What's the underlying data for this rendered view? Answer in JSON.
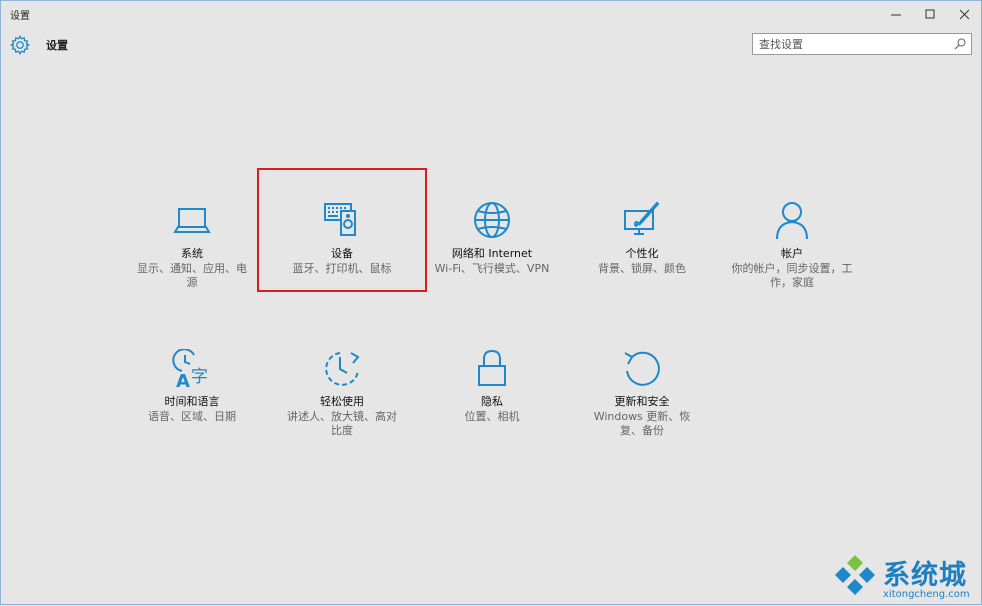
{
  "window": {
    "title": "设置",
    "controls": {
      "minimize": "—",
      "maximize": "☐",
      "close": "✕"
    }
  },
  "header": {
    "app_name": "设置",
    "icon": "gear-icon"
  },
  "search": {
    "placeholder": "查找设置",
    "icon": "search-icon"
  },
  "accent_color": "#1e88c9",
  "highlight_color": "#d81e1e",
  "tiles": [
    {
      "id": "system",
      "label": "系统",
      "desc": "显示、通知、应用、电\n源",
      "icon": "laptop-icon"
    },
    {
      "id": "devices",
      "label": "设备",
      "desc": "蓝牙、打印机、鼠标",
      "icon": "devices-icon",
      "highlighted": true
    },
    {
      "id": "network",
      "label": "网络和 Internet",
      "desc": "Wi-Fi、飞行模式、VPN",
      "icon": "globe-icon"
    },
    {
      "id": "personalization",
      "label": "个性化",
      "desc": "背景、锁屏、颜色",
      "icon": "paint-icon"
    },
    {
      "id": "accounts",
      "label": "帐户",
      "desc": "你的帐户，同步设置，工\n作，家庭",
      "icon": "person-icon"
    },
    {
      "id": "time",
      "label": "时间和语言",
      "desc": "语音、区域、日期",
      "icon": "time-language-icon"
    },
    {
      "id": "ease",
      "label": "轻松使用",
      "desc": "讲述人、放大镜、高对\n比度",
      "icon": "ease-of-access-icon"
    },
    {
      "id": "privacy",
      "label": "隐私",
      "desc": "位置、相机",
      "icon": "lock-icon"
    },
    {
      "id": "update",
      "label": "更新和安全",
      "desc": "Windows 更新、恢\n复、备份",
      "icon": "refresh-icon"
    }
  ],
  "watermark": {
    "text": "系统城",
    "url": "xitongcheng.com"
  }
}
